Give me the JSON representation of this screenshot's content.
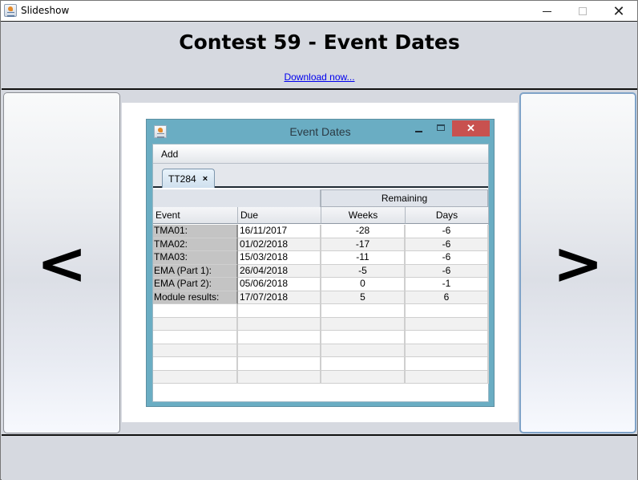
{
  "window": {
    "title": "Slideshow",
    "controls": {
      "minimize": "minimize",
      "maximize": "maximize",
      "close": "✕"
    }
  },
  "header": {
    "title": "Contest 59 - Event Dates",
    "link": "Download now..."
  },
  "nav": {
    "prev": "<",
    "next": ">"
  },
  "slide": {
    "window_title": "Event Dates",
    "close_glyph": "✕",
    "menu": [
      "Add"
    ],
    "tabs": [
      {
        "label": "TT284",
        "close": "×"
      }
    ],
    "table": {
      "group_header": "Remaining",
      "columns": [
        "Event",
        "Due",
        "Weeks",
        "Days"
      ],
      "rows": [
        [
          "TMA01:",
          "16/11/2017",
          "-28",
          "-6"
        ],
        [
          "TMA02:",
          "01/02/2018",
          "-17",
          "-6"
        ],
        [
          "TMA03:",
          "15/03/2018",
          "-11",
          "-6"
        ],
        [
          "EMA (Part 1):",
          "26/04/2018",
          "-5",
          "-6"
        ],
        [
          "EMA (Part 2):",
          "05/06/2018",
          "0",
          "-1"
        ],
        [
          "Module results:",
          "17/07/2018",
          "5",
          "6"
        ],
        [
          "",
          "",
          "",
          ""
        ],
        [
          "",
          "",
          "",
          ""
        ],
        [
          "",
          "",
          "",
          ""
        ],
        [
          "",
          "",
          "",
          ""
        ],
        [
          "",
          "",
          "",
          ""
        ],
        [
          "",
          "",
          "",
          ""
        ]
      ]
    }
  }
}
